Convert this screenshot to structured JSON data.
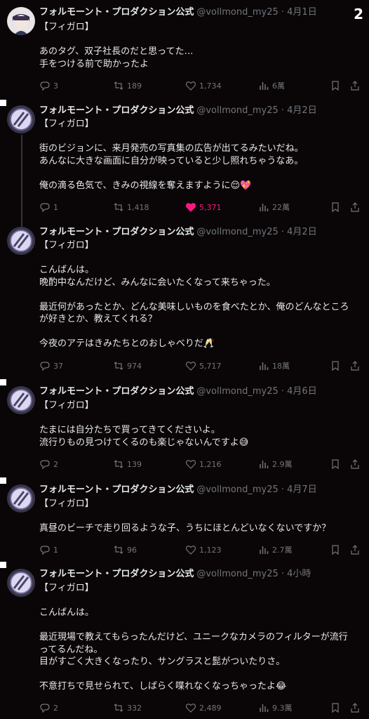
{
  "corner_badge": "2",
  "tweets": [
    {
      "name": "フォルモーント・プロダクション公式",
      "handle": "@vollmond_my25",
      "date": "4月1日",
      "lines": [
        "【フィガロ】",
        "",
        "あのタグ、双子社長のだと思ってた…",
        "手をつける前で助かったよ"
      ],
      "replies": "3",
      "retweets": "189",
      "likes": "1,734",
      "views": "6萬",
      "liked": false
    },
    {
      "name": "フォルモーント・プロダクション公式",
      "handle": "@vollmond_my25",
      "date": "4月2日",
      "lines": [
        "【フィガロ】",
        "",
        "街のビジョンに、来月発売の写真集の広告が出てるみたいだね。",
        "あんなに大きな画面に自分が映っていると少し照れちゃうなあ。",
        "",
        "俺の滴る色気で、きみの視線を奪えますように😌💖"
      ],
      "replies": "1",
      "retweets": "1,418",
      "likes": "5,371",
      "views": "22萬",
      "liked": true
    },
    {
      "name": "フォルモーント・プロダクション公式",
      "handle": "@vollmond_my25",
      "date": "4月2日",
      "lines": [
        "【フィガロ】",
        "",
        "こんばんは。",
        "晩酌中なんだけど、みんなに会いたくなって来ちゃった。",
        "",
        "最近何があったとか、どんな美味しいものを食べたとか、俺のどんなところ",
        "が好きとか、教えてくれる？",
        "",
        "今夜のアテはきみたちとのおしゃべりだ🥂"
      ],
      "replies": "37",
      "retweets": "974",
      "likes": "5,717",
      "views": "18萬",
      "liked": false
    },
    {
      "name": "フォルモーント・プロダクション公式",
      "handle": "@vollmond_my25",
      "date": "4月6日",
      "lines": [
        "【フィガロ】",
        "",
        "たまには自分たちで買ってきてくださいよ。",
        "流行りもの見つけてくるのも楽じゃないんですよ😅"
      ],
      "replies": "2",
      "retweets": "139",
      "likes": "1,216",
      "views": "2.9萬",
      "liked": false
    },
    {
      "name": "フォルモーント・プロダクション公式",
      "handle": "@vollmond_my25",
      "date": "4月7日",
      "lines": [
        "【フィガロ】",
        "",
        "真昼のビーチで走り回るような子、うちにほとんどいなくないですか？"
      ],
      "replies": "1",
      "retweets": "96",
      "likes": "1,123",
      "views": "2.7萬",
      "liked": false
    },
    {
      "name": "フォルモーント・プロダクション公式",
      "handle": "@vollmond_my25",
      "date": "4小時",
      "lines": [
        "【フィガロ】",
        "",
        "こんばんは。",
        "",
        "最近現場で教えてもらったんだけど、ユニークなカメラのフィルターが流行",
        "ってるんだね。",
        "目がすごく大きくなったり、サングラスと髭がついたりさ。",
        "",
        "不意打ちで見せられて、しばらく喋れなくなっちゃったよ😂"
      ],
      "replies": "2",
      "retweets": "332",
      "likes": "2,489",
      "views": "9.3萬",
      "liked": false
    }
  ]
}
